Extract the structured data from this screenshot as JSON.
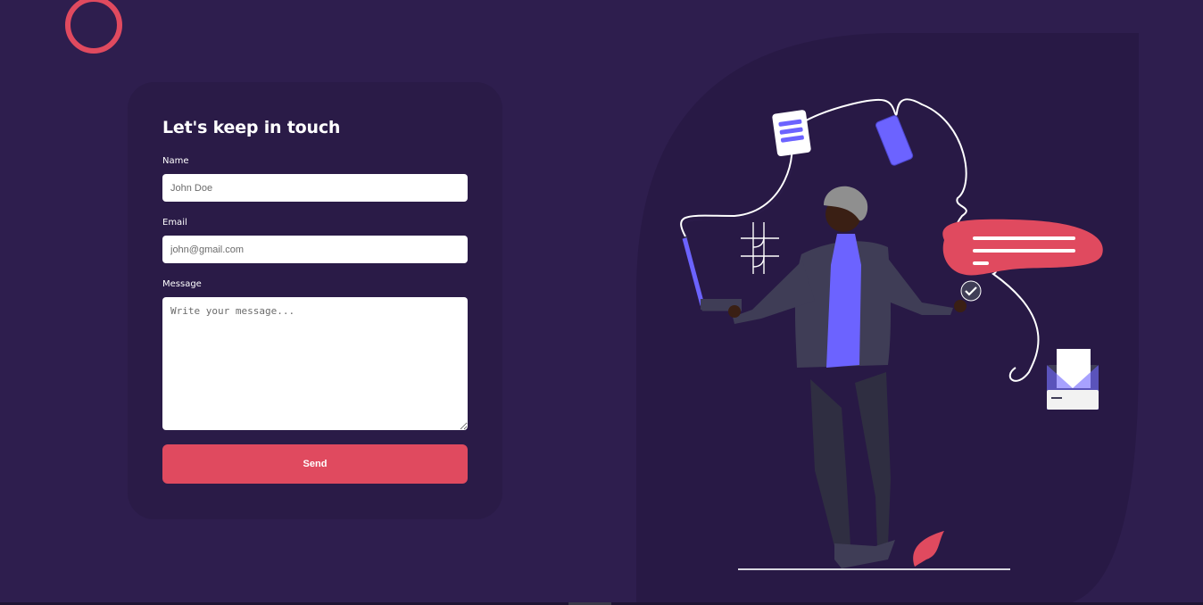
{
  "form": {
    "title": "Let's keep in touch",
    "name_label": "Name",
    "name_placeholder": "John Doe",
    "email_label": "Email",
    "email_placeholder": "john@gmail.com",
    "message_label": "Message",
    "message_placeholder": "Write your message...",
    "send_label": "Send"
  },
  "colors": {
    "background": "#2e1e4e",
    "card": "#2a1b47",
    "accent": "#e04a5f",
    "illustration_purple": "#6c63ff"
  },
  "icons": [
    "logo-ring-icon",
    "contact-illustration"
  ]
}
